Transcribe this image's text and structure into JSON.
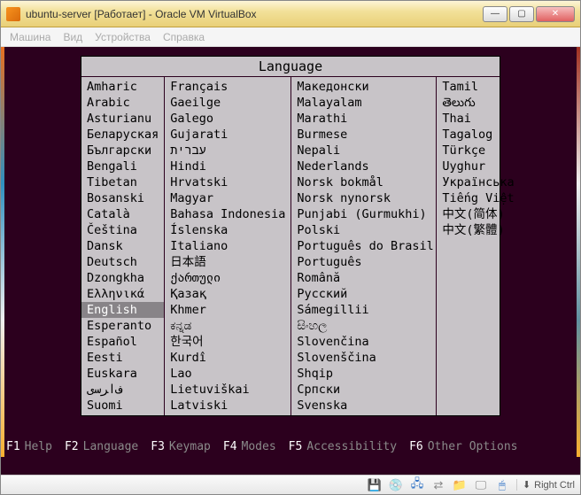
{
  "window": {
    "title": "ubuntu-server [Работает] - Oracle VM VirtualBox",
    "btn_min": "—",
    "btn_max": "▢",
    "btn_close": "✕"
  },
  "menubar": {
    "machine": "Машина",
    "view": "Вид",
    "devices": "Устройства",
    "help": "Справка"
  },
  "lang_panel": {
    "header": "Language",
    "selected": "English",
    "columns": [
      [
        "Amharic",
        "Arabic",
        "Asturianu",
        "Беларуская",
        "Български",
        "Bengali",
        "Tibetan",
        "Bosanski",
        "Català",
        "Čeština",
        "Dansk",
        "Deutsch",
        "Dzongkha",
        "Ελληνικά",
        "English",
        "Esperanto",
        "Español",
        "Eesti",
        "Euskara",
        "ﻑﺍﺮﺳی",
        "Suomi"
      ],
      [
        "Français",
        "Gaeilge",
        "Galego",
        "Gujarati",
        "עברית",
        "Hindi",
        "Hrvatski",
        "Magyar",
        "Bahasa Indonesia",
        "Íslenska",
        "Italiano",
        "日本語",
        "ქართული",
        "Қазақ",
        "Khmer",
        "ಕನ್ನಡ",
        "한국어",
        "Kurdî",
        "Lao",
        "Lietuviškai",
        "Latviski"
      ],
      [
        "Македонски",
        "Malayalam",
        "Marathi",
        "Burmese",
        "Nepali",
        "Nederlands",
        "Norsk bokmål",
        "Norsk nynorsk",
        "Punjabi (Gurmukhi)",
        "Polski",
        "Português do Brasil",
        "Português",
        "Română",
        "Русский",
        "Sámegillii",
        "සිංහල",
        "Slovenčina",
        "Slovenščina",
        "Shqip",
        "Српски",
        "Svenska"
      ],
      [
        "Tamil",
        "తెలుగు",
        "Thai",
        "Tagalog",
        "Türkçe",
        "Uyghur",
        "Українська",
        "Tiếng Việt",
        "中文(简体)",
        "中文(繁體)"
      ]
    ]
  },
  "fkeys": [
    {
      "key": "F1",
      "label": "Help"
    },
    {
      "key": "F2",
      "label": "Language"
    },
    {
      "key": "F3",
      "label": "Keymap"
    },
    {
      "key": "F4",
      "label": "Modes"
    },
    {
      "key": "F5",
      "label": "Accessibility"
    },
    {
      "key": "F6",
      "label": "Other Options"
    }
  ],
  "statusbar": {
    "icons": {
      "disk": "💾",
      "cd": "💿",
      "net": "🖧",
      "usb": "⇄",
      "shared": "📁",
      "video": "🖵",
      "mouse": "🖱"
    },
    "host_icon": "⬇",
    "host_label": "Right Ctrl"
  }
}
